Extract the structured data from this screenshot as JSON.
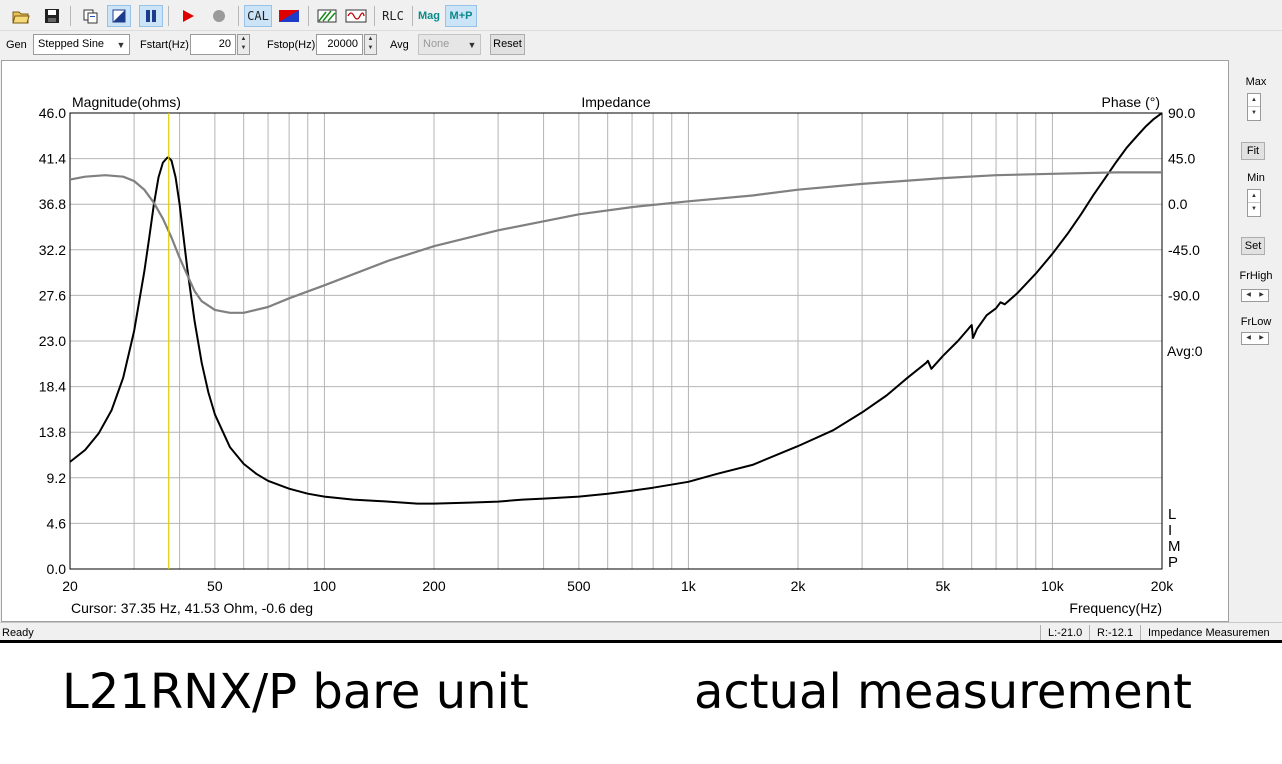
{
  "toolbar": {
    "buttons": [
      {
        "name": "open-icon"
      },
      {
        "name": "save-icon"
      },
      {
        "name": "copy-icon"
      },
      {
        "name": "marker-icon"
      },
      {
        "name": "pause-icon"
      },
      {
        "name": "play-icon"
      },
      {
        "name": "stop-icon"
      },
      {
        "name": "cal-button",
        "label": "CAL"
      },
      {
        "name": "color-icon"
      },
      {
        "name": "chart-icon"
      },
      {
        "name": "wave-icon"
      },
      {
        "name": "rlc-button",
        "label": "RLC"
      },
      {
        "name": "mag-button",
        "label": "Mag"
      },
      {
        "name": "mp-button",
        "label": "M+P"
      }
    ]
  },
  "genbar": {
    "gen_label": "Gen",
    "gen_value": "Stepped Sine",
    "fstart_label": "Fstart(Hz)",
    "fstart_value": "20",
    "fstop_label": "Fstop(Hz)",
    "fstop_value": "20000",
    "avg_label": "Avg",
    "avg_value": "None",
    "reset_label": "Reset"
  },
  "plot": {
    "left_title": "Magnitude(ohms)",
    "center_title": "Impedance",
    "right_title": "Phase (°)",
    "avg_label": "Avg:0",
    "limp_label": [
      "L",
      "I",
      "M",
      "P"
    ],
    "cursor_text": "Cursor: 37.35 Hz, 41.53 Ohm, -0.6 deg",
    "x_axis_label": "Frequency(Hz)"
  },
  "chart_data": {
    "type": "line",
    "title": "Impedance",
    "xlabel": "Frequency(Hz)",
    "ylabel": "Magnitude(ohms)",
    "y2label": "Phase (°)",
    "x_scale": "log",
    "xlim": [
      20,
      20000
    ],
    "ylim": [
      0,
      46
    ],
    "y2lim": [
      -225,
      90
    ],
    "x_ticks": [
      {
        "value": 20,
        "label": "20"
      },
      {
        "value": 50,
        "label": "50"
      },
      {
        "value": 100,
        "label": "100"
      },
      {
        "value": 200,
        "label": "200"
      },
      {
        "value": 500,
        "label": "500"
      },
      {
        "value": 1000,
        "label": "1k"
      },
      {
        "value": 2000,
        "label": "2k"
      },
      {
        "value": 5000,
        "label": "5k"
      },
      {
        "value": 10000,
        "label": "10k"
      },
      {
        "value": 20000,
        "label": "20k"
      }
    ],
    "y_ticks": [
      "46.0",
      "41.4",
      "36.8",
      "32.2",
      "27.6",
      "23.0",
      "18.4",
      "13.8",
      "9.2",
      "4.6",
      "0.0"
    ],
    "y2_ticks": [
      "90.0",
      "45.0",
      "0.0",
      "-45.0",
      "-90.0"
    ],
    "cursor_x": 37.35,
    "grid": true,
    "series": [
      {
        "name": "Magnitude",
        "color": "#000000",
        "x": [
          20,
          22,
          24,
          26,
          28,
          30,
          32,
          33,
          34,
          35,
          36,
          37,
          37.35,
          38,
          39,
          40,
          41,
          42,
          44,
          46,
          48,
          50,
          55,
          60,
          65,
          70,
          80,
          90,
          100,
          120,
          150,
          180,
          200,
          250,
          300,
          350,
          400,
          500,
          600,
          700,
          800,
          1000,
          1200,
          1500,
          2000,
          2500,
          3000,
          3500,
          4000,
          4500,
          4550,
          4650,
          5000,
          5500,
          5900,
          6000,
          6050,
          6200,
          6600,
          7000,
          7200,
          7400,
          8000,
          9000,
          10000,
          11000,
          12000,
          13000,
          14000,
          15000,
          16000,
          17000,
          18000,
          19000,
          20000
        ],
        "values": [
          10.8,
          12.0,
          13.7,
          16.0,
          19.3,
          24.0,
          30.0,
          33.4,
          36.8,
          39.5,
          41.0,
          41.5,
          41.5,
          41.2,
          39.5,
          36.8,
          33.5,
          30.3,
          25.0,
          20.8,
          17.8,
          15.6,
          12.3,
          10.6,
          9.6,
          8.9,
          8.1,
          7.6,
          7.3,
          7.0,
          6.8,
          6.6,
          6.6,
          6.7,
          6.8,
          7.0,
          7.1,
          7.3,
          7.6,
          7.9,
          8.2,
          8.8,
          9.6,
          10.5,
          12.4,
          14.0,
          15.8,
          17.5,
          19.3,
          20.8,
          21.0,
          20.2,
          21.5,
          23.0,
          24.3,
          24.6,
          23.3,
          24.2,
          25.6,
          26.3,
          26.9,
          26.7,
          27.8,
          29.8,
          31.8,
          33.8,
          35.8,
          37.8,
          39.5,
          41.1,
          42.5,
          43.6,
          44.6,
          45.4,
          46.0
        ]
      },
      {
        "name": "Phase",
        "color": "#808080",
        "x": [
          20,
          22,
          25,
          28,
          30,
          32,
          34,
          36,
          38,
          40,
          42,
          44,
          46,
          50,
          55,
          60,
          70,
          80,
          100,
          150,
          200,
          300,
          500,
          700,
          1000,
          1500,
          2000,
          3000,
          5000,
          7000,
          10000,
          15000,
          20000
        ],
        "values": [
          44,
          46,
          47,
          46,
          43,
          37,
          28,
          17,
          4,
          -10,
          -22,
          -33,
          -40,
          -46,
          -48,
          -48,
          -44,
          -38,
          -29,
          -12,
          -2,
          9,
          20,
          25,
          29,
          33,
          37,
          41,
          45,
          47,
          48,
          49,
          49
        ]
      }
    ]
  },
  "rpanel": {
    "max_label": "Max",
    "fit_label": "Fit",
    "min_label": "Min",
    "set_label": "Set",
    "frhigh_label": "FrHigh",
    "frlow_label": "FrLow"
  },
  "status": {
    "ready": "Ready",
    "left": "L:-21.0",
    "right": "R:-12.1",
    "mode": "Impedance Measuremen"
  },
  "caption": {
    "left": "L21RNX/P bare unit",
    "right": "actual measurement"
  }
}
